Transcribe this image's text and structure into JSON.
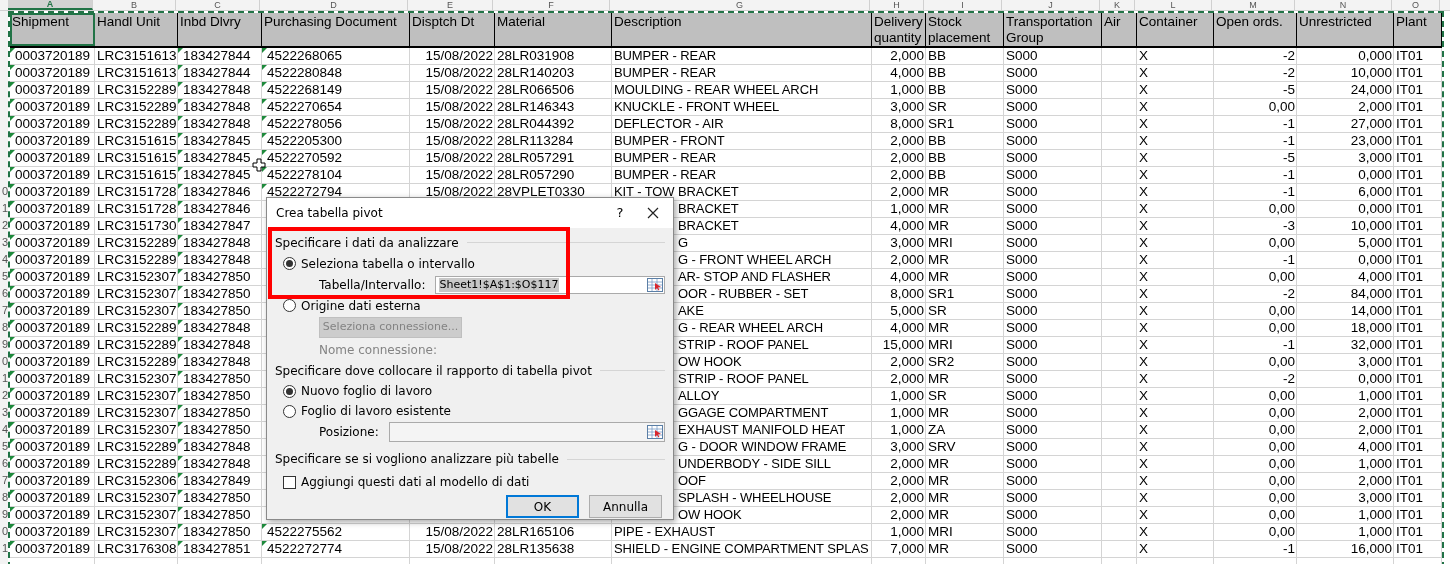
{
  "columns": [
    {
      "letter": "A",
      "selected": true
    },
    {
      "letter": "B",
      "selected": false
    },
    {
      "letter": "C",
      "selected": false
    },
    {
      "letter": "D",
      "selected": false
    },
    {
      "letter": "E",
      "selected": false
    },
    {
      "letter": "F",
      "selected": false
    },
    {
      "letter": "G",
      "selected": false
    },
    {
      "letter": "H",
      "selected": false
    },
    {
      "letter": "I",
      "selected": false
    },
    {
      "letter": "J",
      "selected": false
    },
    {
      "letter": "K",
      "selected": false
    },
    {
      "letter": "L",
      "selected": false
    },
    {
      "letter": "M",
      "selected": false
    },
    {
      "letter": "N",
      "selected": false
    },
    {
      "letter": "O",
      "selected": false
    }
  ],
  "headers": [
    "Shipment",
    "Handl Unit",
    "Inbd Dlvry",
    "Purchasing Document",
    "Disptch Dt",
    "Material",
    "Description",
    "Delivery quantity",
    "Stock placement",
    "Transportation Group",
    "Air",
    "Container",
    "Open ords.",
    "Unrestricted",
    "Plant"
  ],
  "rows": [
    {
      "cells": [
        "0003720189",
        "LRC3151613",
        "183427844",
        "4522268065",
        "15/08/2022",
        "28LR031908",
        "BUMPER - REAR",
        "2,000",
        "BB",
        "S000",
        null,
        "X",
        "-2",
        "0,000",
        "IT01"
      ]
    },
    {
      "cells": [
        "0003720189",
        "LRC3151613",
        "183427844",
        "4522280848",
        "15/08/2022",
        "28LR140203",
        "BUMPER - REAR",
        "4,000",
        "BB",
        "S000",
        null,
        "X",
        "-2",
        "10,000",
        "IT01"
      ]
    },
    {
      "cells": [
        "0003720189",
        "LRC3152289",
        "183427848",
        "4522268149",
        "15/08/2022",
        "28LR066506",
        "MOULDING - REAR WHEEL ARCH",
        "1,000",
        "BB",
        "S000",
        null,
        "X",
        "-5",
        "24,000",
        "IT01"
      ]
    },
    {
      "cells": [
        "0003720189",
        "LRC3152289",
        "183427848",
        "4522270654",
        "15/08/2022",
        "28LR146343",
        "KNUCKLE - FRONT WHEEL",
        "3,000",
        "SR",
        "S000",
        null,
        "X",
        "0,00",
        "2,000",
        "IT01"
      ]
    },
    {
      "cells": [
        "0003720189",
        "LRC3152289",
        "183427848",
        "4522278056",
        "15/08/2022",
        "28LR044392",
        "DEFLECTOR - AIR",
        "8,000",
        "SR1",
        "S000",
        null,
        "X",
        "-1",
        "27,000",
        "IT01"
      ]
    },
    {
      "cells": [
        "0003720189",
        "LRC3151615",
        "183427845",
        "4522205300",
        "15/08/2022",
        "28LR113284",
        "BUMPER - FRONT",
        "2,000",
        "BB",
        "S000",
        null,
        "X",
        "-1",
        "23,000",
        "IT01"
      ]
    },
    {
      "cells": [
        "0003720189",
        "LRC3151615",
        "183427845",
        "4522270592",
        "15/08/2022",
        "28LR057291",
        "BUMPER - REAR",
        "2,000",
        "BB",
        "S000",
        null,
        "X",
        "-5",
        "3,000",
        "IT01"
      ]
    },
    {
      "cells": [
        "0003720189",
        "LRC3151615",
        "183427845",
        "4522278104",
        "15/08/2022",
        "28LR057290",
        "BUMPER - REAR",
        "2,000",
        "BB",
        "S000",
        null,
        "X",
        "-1",
        "0,000",
        "IT01"
      ]
    },
    {
      "row_number": "0",
      "cells": [
        "0003720189",
        "LRC3151728",
        "183427846",
        "4522272794",
        "15/08/2022",
        "28VPLET0330",
        "KIT - TOW BRACKET",
        "2,000",
        "MR",
        "S000",
        null,
        "X",
        "-1",
        "6,000",
        "IT01"
      ]
    },
    {
      "row_number": "1",
      "cells": [
        "0003720189",
        "LRC3151728",
        "183427846",
        null,
        null,
        null,
        "BRACKET",
        "1,000",
        "MR",
        "S000",
        null,
        "X",
        "0,00",
        "0,000",
        "IT01"
      ]
    },
    {
      "row_number": "2",
      "cells": [
        "0003720189",
        "LRC3151730",
        "183427847",
        null,
        null,
        null,
        "BRACKET",
        "4,000",
        "MR",
        "S000",
        null,
        "X",
        "-3",
        "10,000",
        "IT01"
      ]
    },
    {
      "row_number": "3",
      "cells": [
        "0003720189",
        "LRC3152289",
        "183427848",
        null,
        null,
        null,
        "G",
        "3,000",
        "MRI",
        "S000",
        null,
        "X",
        "0,00",
        "5,000",
        "IT01"
      ]
    },
    {
      "row_number": "4",
      "cells": [
        "0003720189",
        "LRC3152289",
        "183427848",
        null,
        null,
        null,
        "G - FRONT WHEEL ARCH",
        "2,000",
        "MR",
        "S000",
        null,
        "X",
        "-1",
        "0,000",
        "IT01"
      ]
    },
    {
      "row_number": "5",
      "cells": [
        "0003720189",
        "LRC3152307",
        "183427850",
        null,
        null,
        null,
        "AR- STOP AND FLASHER",
        "4,000",
        "MR",
        "S000",
        null,
        "X",
        "0,00",
        "4,000",
        "IT01"
      ]
    },
    {
      "row_number": "6",
      "cells": [
        "0003720189",
        "LRC3152307",
        "183427850",
        null,
        null,
        null,
        "OOR - RUBBER - SET",
        "8,000",
        "SR1",
        "S000",
        null,
        "X",
        "-2",
        "84,000",
        "IT01"
      ]
    },
    {
      "row_number": "7",
      "cells": [
        "0003720189",
        "LRC3152307",
        "183427850",
        null,
        null,
        null,
        "AKE",
        "5,000",
        "SR",
        "S000",
        null,
        "X",
        "0,00",
        "14,000",
        "IT01"
      ]
    },
    {
      "row_number": "8",
      "cells": [
        "0003720189",
        "LRC3152289",
        "183427848",
        null,
        null,
        null,
        "G - REAR WHEEL ARCH",
        "4,000",
        "MR",
        "S000",
        null,
        "X",
        "0,00",
        "18,000",
        "IT01"
      ]
    },
    {
      "row_number": "9",
      "cells": [
        "0003720189",
        "LRC3152289",
        "183427848",
        null,
        null,
        null,
        "STRIP - ROOF PANEL",
        "15,000",
        "MRI",
        "S000",
        null,
        "X",
        "-1",
        "32,000",
        "IT01"
      ]
    },
    {
      "row_number": "0",
      "cells": [
        "0003720189",
        "LRC3152289",
        "183427848",
        null,
        null,
        null,
        "OW HOOK",
        "2,000",
        "SR2",
        "S000",
        null,
        "X",
        "0,00",
        "3,000",
        "IT01"
      ]
    },
    {
      "row_number": "1",
      "cells": [
        "0003720189",
        "LRC3152307",
        "183427850",
        null,
        null,
        null,
        "STRIP - ROOF PANEL",
        "2,000",
        "MR",
        "S000",
        null,
        "X",
        "-2",
        "0,000",
        "IT01"
      ]
    },
    {
      "row_number": "2",
      "cells": [
        "0003720189",
        "LRC3152307",
        "183427850",
        null,
        null,
        null,
        "ALLOY",
        "1,000",
        "SR",
        "S000",
        null,
        "X",
        "0,00",
        "1,000",
        "IT01"
      ]
    },
    {
      "row_number": "3",
      "cells": [
        "0003720189",
        "LRC3152307",
        "183427850",
        null,
        null,
        null,
        "GGAGE COMPARTMENT",
        "1,000",
        "MR",
        "S000",
        null,
        "X",
        "0,00",
        "2,000",
        "IT01"
      ]
    },
    {
      "row_number": "4",
      "cells": [
        "0003720189",
        "LRC3152307",
        "183427850",
        null,
        null,
        null,
        "EXHAUST MANIFOLD HEAT",
        "1,000",
        "ZA",
        "S000",
        null,
        "X",
        "0,00",
        "2,000",
        "IT01"
      ]
    },
    {
      "row_number": "5",
      "cells": [
        "0003720189",
        "LRC3152289",
        "183427848",
        null,
        null,
        null,
        "G - DOOR WINDOW FRAME",
        "3,000",
        "SRV",
        "S000",
        null,
        "X",
        "0,00",
        "4,000",
        "IT01"
      ]
    },
    {
      "row_number": "6",
      "cells": [
        "0003720189",
        "LRC3152289",
        "183427848",
        null,
        null,
        null,
        "UNDERBODY - SIDE SILL",
        "2,000",
        "MR",
        "S000",
        null,
        "X",
        "0,00",
        "1,000",
        "IT01"
      ]
    },
    {
      "row_number": "7",
      "cells": [
        "0003720189",
        "LRC3152306",
        "183427849",
        null,
        null,
        null,
        "OOF",
        "2,000",
        "MR",
        "S000",
        null,
        "X",
        "0,00",
        "2,000",
        "IT01"
      ]
    },
    {
      "row_number": "8",
      "cells": [
        "0003720189",
        "LRC3152307",
        "183427850",
        null,
        null,
        null,
        "SPLASH - WHEELHOUSE",
        "2,000",
        "MR",
        "S000",
        null,
        "X",
        "0,00",
        "3,000",
        "IT01"
      ]
    },
    {
      "row_number": "9",
      "cells": [
        "0003720189",
        "LRC3152307",
        "183427850",
        null,
        null,
        null,
        "OW HOOK",
        "2,000",
        "MR",
        "S000",
        null,
        "X",
        "0,00",
        "1,000",
        "IT01"
      ]
    },
    {
      "row_number": "0",
      "cells": [
        "0003720189",
        "LRC3152307",
        "183427850",
        "4522275562",
        "15/08/2022",
        "28LR165106",
        "PIPE - EXHAUST",
        "1,000",
        "MRI",
        "S000",
        null,
        "X",
        "0,00",
        "1,000",
        "IT01"
      ]
    },
    {
      "row_number": "1",
      "cells": [
        "0003720189",
        "LRC3176308",
        "183427851",
        "4522272774",
        "15/08/2022",
        "28LR135638",
        "SHIELD - ENGINE COMPARTMENT SPLAS",
        "7,000",
        "MR",
        "S000",
        null,
        "X",
        "-1",
        "16,000",
        "IT01"
      ]
    }
  ],
  "dialog": {
    "title": "Crea tabella pivot",
    "help": "?",
    "section_data": "Specificare i dati da analizzare",
    "radio_table": {
      "label": "Seleziona tabella o intervallo",
      "selected": true
    },
    "range_field": {
      "label": "Tabella/Intervallo:",
      "value": "Sheet1!$A$1:$O$117"
    },
    "radio_external": {
      "label": "Origine dati esterna",
      "selected": false
    },
    "connection_button": {
      "label": "Seleziona connessione...",
      "disabled": true
    },
    "connection_name": {
      "label": "Nome connessione:",
      "disabled": true
    },
    "section_place": "Specificare dove collocare il rapporto di tabella pivot",
    "radio_new": {
      "label": "Nuovo foglio di lavoro",
      "selected": true
    },
    "radio_existing": {
      "label": "Foglio di lavoro esistente",
      "selected": false
    },
    "position_field": {
      "label": "Posizione:"
    },
    "section_multi": "Specificare se si vogliono analizzare più tabelle",
    "model_checkbox": {
      "label": "Aggiungi questi dati al modello di dati",
      "checked": false
    },
    "buttons": [
      {
        "label": "OK",
        "default": true
      },
      {
        "label": "Annulla",
        "default": false
      }
    ]
  }
}
